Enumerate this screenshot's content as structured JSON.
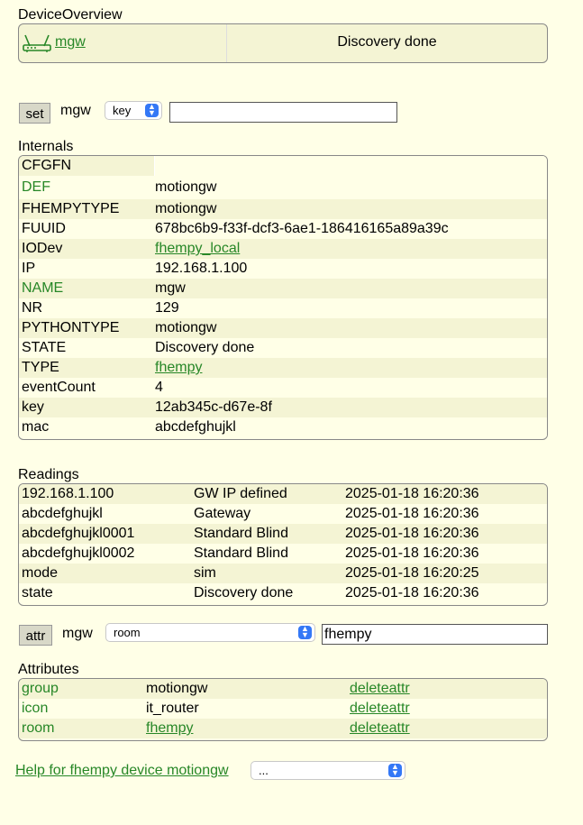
{
  "overview": {
    "title": "DeviceOverview",
    "device_link": "mgw",
    "device_icon": "router-icon",
    "state": "Discovery done"
  },
  "set_bar": {
    "button": "set",
    "device": "mgw",
    "select_value": "key",
    "input_value": ""
  },
  "internals": {
    "title": "Internals",
    "rows": [
      {
        "name": "CFGFN",
        "value": ""
      },
      {
        "name": "DEF",
        "value": "motiongw"
      },
      {
        "name": "FHEMPYTYPE",
        "value": "motiongw"
      },
      {
        "name": "FUUID",
        "value": "678bc6b9-f33f-dcf3-6ae1-186416165a89a39c"
      },
      {
        "name": "IODev",
        "value": "fhempy_local"
      },
      {
        "name": "IP",
        "value": "192.168.1.100"
      },
      {
        "name": "NAME",
        "value": "mgw"
      },
      {
        "name": "NR",
        "value": "129"
      },
      {
        "name": "PYTHONTYPE",
        "value": "motiongw"
      },
      {
        "name": "STATE",
        "value": "Discovery done"
      },
      {
        "name": "TYPE",
        "value": "fhempy"
      },
      {
        "name": "eventCount",
        "value": "4"
      },
      {
        "name": "key",
        "value": "12ab345c-d67e-8f"
      },
      {
        "name": "mac",
        "value": "abcdefghujkl"
      }
    ]
  },
  "readings": {
    "title": "Readings",
    "rows": [
      {
        "name": "192.168.1.100",
        "value": "GW IP defined",
        "time": "2025-01-18 16:20:36"
      },
      {
        "name": "abcdefghujkl",
        "value": "Gateway",
        "time": "2025-01-18 16:20:36"
      },
      {
        "name": "abcdefghujkl0001",
        "value": "Standard Blind",
        "time": "2025-01-18 16:20:36"
      },
      {
        "name": "abcdefghujkl0002",
        "value": "Standard Blind",
        "time": "2025-01-18 16:20:36"
      },
      {
        "name": "mode",
        "value": "sim",
        "time": "2025-01-18 16:20:25"
      },
      {
        "name": "state",
        "value": "Discovery done",
        "time": "2025-01-18 16:20:36"
      }
    ]
  },
  "attr_bar": {
    "button": "attr",
    "device": "mgw",
    "select_value": "room",
    "input_value": "fhempy"
  },
  "attributes": {
    "title": "Attributes",
    "rows": [
      {
        "name": "group",
        "value": "motiongw",
        "action": "deleteattr"
      },
      {
        "name": "icon",
        "value": "it_router",
        "action": "deleteattr"
      },
      {
        "name": "room",
        "value": "fhempy",
        "action": "deleteattr"
      }
    ]
  },
  "footer": {
    "help_link": "Help for fhempy device motiongw",
    "select_value": "..."
  },
  "colors": {
    "background": "#FFFFE7",
    "row_alt": "#F4F4D4",
    "link": "#278727",
    "select_arrow": "#3478F6"
  }
}
